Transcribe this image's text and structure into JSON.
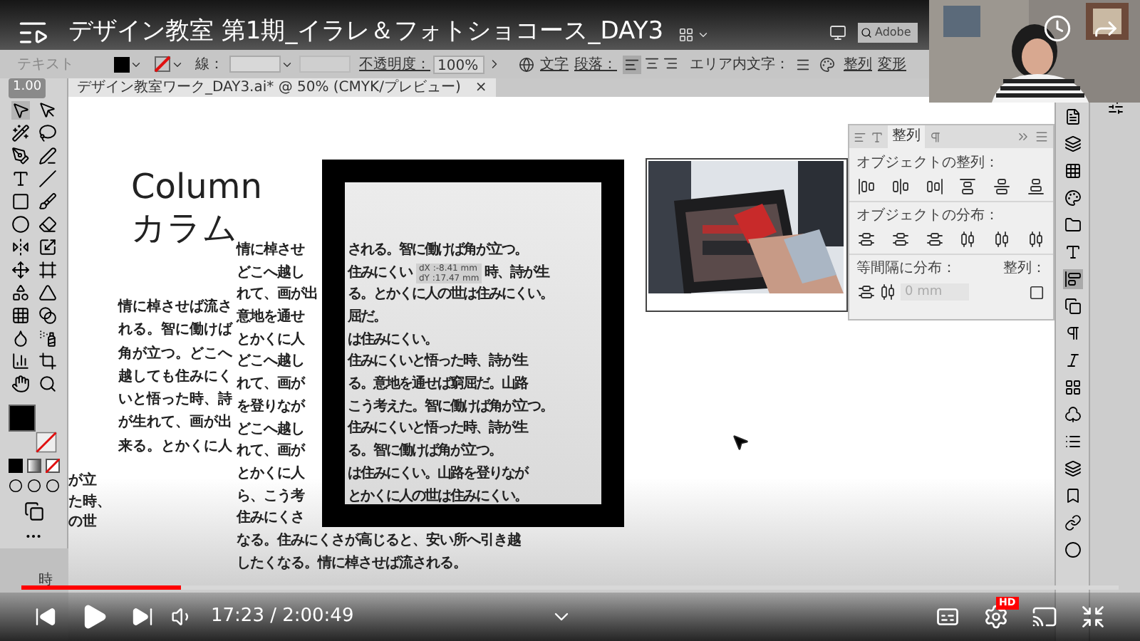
{
  "video": {
    "title": "デザイン教室 第1期_イラレ＆フォトショコース_DAY3",
    "speed": "1.00",
    "time": "17:23 / 2:00:49",
    "progress": {
      "level": 0.145
    },
    "hd_badge": "HD"
  },
  "menu_bar": {
    "search": "Adobe"
  },
  "control_bar": {
    "selection": "テキスト",
    "stroke_label": "線：",
    "opacity_label": "不透明度：",
    "opacity": "100%",
    "character": "文字",
    "paragraph": "段落：",
    "area_type": "エリア内文字：",
    "align": "整列",
    "transform": "変形"
  },
  "document_tab": {
    "title": "デザイン教室ワーク_DAY3.ai* @ 50% (CMYK/プレビュー)",
    "close": "×"
  },
  "canvas": {
    "heading": "Column",
    "heading_ja": "カラム",
    "side_column": [
      "情に棹させば流さ",
      "れる。智に働けば",
      "角が立つ。どこへ",
      "越しても住みにく",
      "いと悟った時、詩",
      "が生れて、画が出",
      "来る。とかくに人"
    ],
    "cut_column": [
      "が立",
      "た時、",
      "の世"
    ],
    "stray": "時",
    "tooltip": [
      "dX :-8.41 mm",
      "dY :17.47 mm"
    ],
    "main_column": [
      {
        "left": "情に棹させ",
        "right": "される。智に働けば角が立つ。"
      },
      {
        "left": "どこへ越し",
        "right": "住みにくい",
        "after": "時、詩が生"
      },
      {
        "left": "れて、画が出",
        "right": "る。とかくに人の世は住みにくい。"
      },
      {
        "left": "意地を通せ",
        "right": "屈だ。"
      },
      {
        "left": "とかくに人",
        "right": "は住みにくい。"
      },
      {
        "left": "どこへ越し",
        "right": "住みにくいと悟った時、詩が生"
      },
      {
        "left": "れて、画が",
        "right": "る。意地を通せば窮屈だ。山路"
      },
      {
        "left": "を登りなが",
        "right": "こう考えた。智に働けば角が立つ。"
      },
      {
        "left": "どこへ越し",
        "right": "住みにくいと悟った時、詩が生"
      },
      {
        "left": "れて、画が",
        "right": "る。智に働けば角が立つ。"
      },
      {
        "left": "とかくに人",
        "right": "は住みにくい。山路を登りなが"
      },
      {
        "left": "ら、こう考",
        "right": "とかくに人の世は住みにくい。"
      },
      {
        "left": "住みにくさ"
      },
      {
        "left": "なる。住みにくさが高じると、安い所へ引き越"
      },
      {
        "left": "したくなる。情に棹させば流される。"
      }
    ]
  },
  "align_panel": {
    "tabs": [
      {
        "label": "整列",
        "selected": true
      }
    ],
    "align_objects": "オブジェクトの整列：",
    "distribute_objects": "オブジェクトの分布：",
    "distribute_spacing": "等間隔に分布：",
    "align_to": "整列：",
    "spacing_value": "0 mm"
  }
}
